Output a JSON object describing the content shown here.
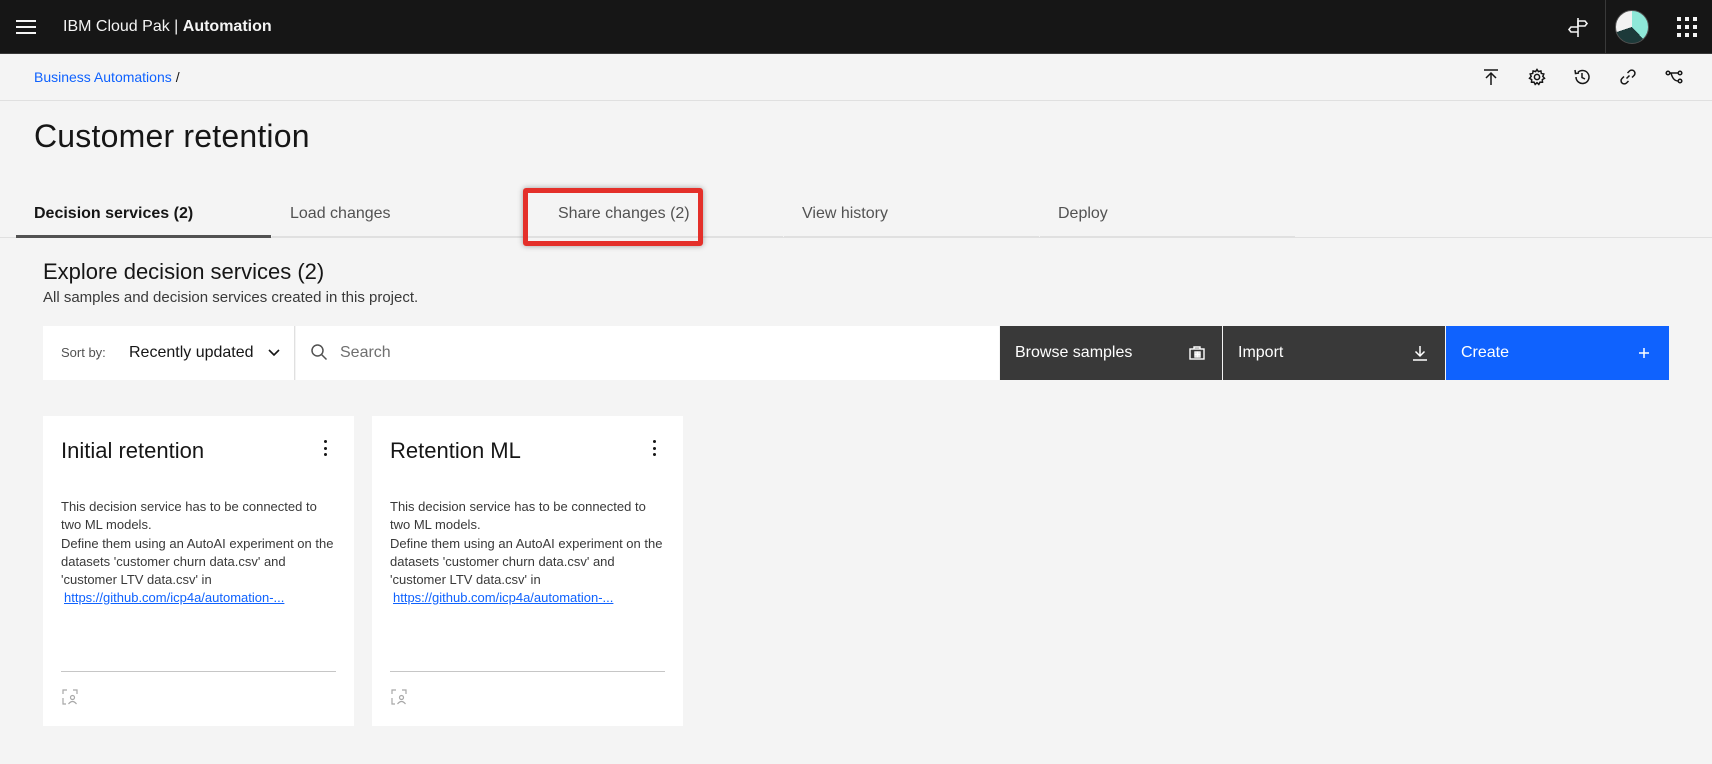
{
  "header": {
    "brand_prefix": "IBM Cloud Pak | ",
    "brand_product": "Automation",
    "icons": [
      "menu-icon",
      "signpost-icon",
      "avatar",
      "app-switcher-icon"
    ]
  },
  "breadcrumb": {
    "link": "Business Automations",
    "separator": "/"
  },
  "toolbar_icons": [
    "publish-icon",
    "settings-icon",
    "history-icon",
    "link-icon",
    "branch-icon"
  ],
  "page": {
    "title": "Customer retention"
  },
  "tabs": [
    {
      "label": "Decision services (2)",
      "active": true
    },
    {
      "label": "Load changes",
      "active": false
    },
    {
      "label": "Share changes (2)",
      "active": false,
      "highlighted": true
    },
    {
      "label": "View history",
      "active": false
    },
    {
      "label": "Deploy",
      "active": false
    }
  ],
  "section": {
    "title": "Explore decision services (2)",
    "subtitle": "All samples and decision services created in this project."
  },
  "controls": {
    "sort_label": "Sort by:",
    "sort_value": "Recently updated",
    "search_placeholder": "Search",
    "browse_label": "Browse samples",
    "import_label": "Import",
    "create_label": "Create"
  },
  "cards": [
    {
      "title": "Initial retention",
      "description": "This decision service has to be connected to two ML models.\n Define them using an AutoAI experiment on the datasets 'customer churn data.csv' and 'customer LTV data.csv' in",
      "link": "https://github.com/icp4a/automation-..."
    },
    {
      "title": "Retention ML",
      "description": "This decision service has to be connected to two ML models.\n Define them using an AutoAI experiment on the datasets 'customer churn data.csv' and 'customer LTV data.csv' in",
      "link": "https://github.com/icp4a/automation-..."
    }
  ],
  "colors": {
    "header_bg": "#161616",
    "page_bg": "#f4f4f4",
    "primary": "#0f62fe",
    "dark_button": "#393939",
    "highlight": "#e4302a"
  }
}
